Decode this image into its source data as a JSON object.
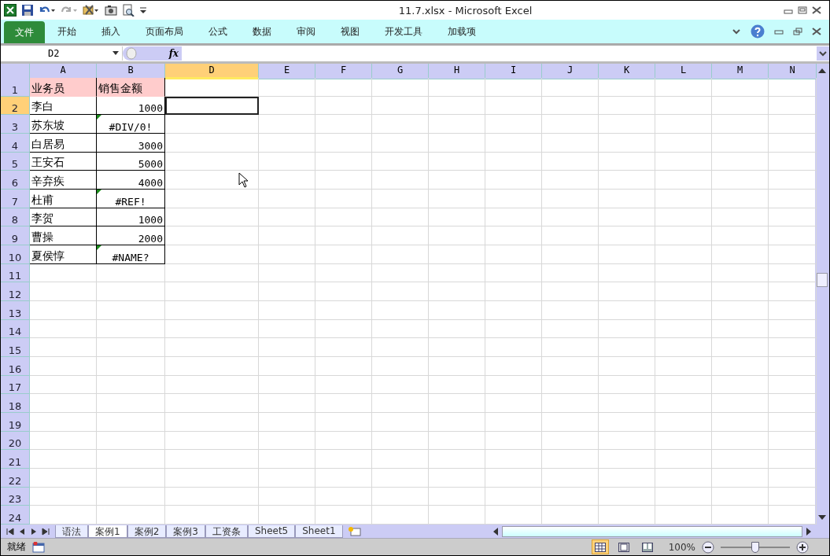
{
  "window": {
    "title": "11.7.xlsx  -  Microsoft Excel"
  },
  "ribbon_tabs": [
    {
      "label": "文件",
      "kind": "file"
    },
    {
      "label": "开始",
      "kind": "tab"
    },
    {
      "label": "插入",
      "kind": "tab"
    },
    {
      "label": "页面布局",
      "kind": "tab"
    },
    {
      "label": "公式",
      "kind": "tab"
    },
    {
      "label": "数据",
      "kind": "tab"
    },
    {
      "label": "审阅",
      "kind": "tab"
    },
    {
      "label": "视图",
      "kind": "tab"
    },
    {
      "label": "开发工具",
      "kind": "tab"
    },
    {
      "label": "加载项",
      "kind": "tab"
    }
  ],
  "formula_bar": {
    "name_box": "D2",
    "fx": "fx"
  },
  "columns": [
    {
      "label": "A",
      "selected": false
    },
    {
      "label": "B",
      "selected": false
    },
    {
      "label": "D",
      "selected": true
    },
    {
      "label": "E",
      "selected": false
    },
    {
      "label": "F",
      "selected": false
    },
    {
      "label": "G",
      "selected": false
    },
    {
      "label": "H",
      "selected": false
    },
    {
      "label": "I",
      "selected": false
    },
    {
      "label": "J",
      "selected": false
    },
    {
      "label": "K",
      "selected": false
    },
    {
      "label": "L",
      "selected": false
    },
    {
      "label": "M",
      "selected": false
    },
    {
      "label": "N",
      "selected": false
    }
  ],
  "rows": [
    {
      "number": "1",
      "selected": false,
      "cells": [
        {
          "text": "业务员",
          "kind": "header",
          "error_flag": false
        },
        {
          "text": "销售金额",
          "kind": "header",
          "error_flag": false
        }
      ]
    },
    {
      "number": "2",
      "selected": true,
      "cells": [
        {
          "text": "李白",
          "kind": "text",
          "error_flag": false
        },
        {
          "text": "1000",
          "kind": "number",
          "error_flag": false
        }
      ]
    },
    {
      "number": "3",
      "selected": false,
      "cells": [
        {
          "text": "苏东坡",
          "kind": "text",
          "error_flag": false
        },
        {
          "text": "#DIV/0!",
          "kind": "error",
          "error_flag": true
        }
      ]
    },
    {
      "number": "4",
      "selected": false,
      "cells": [
        {
          "text": "白居易",
          "kind": "text",
          "error_flag": false
        },
        {
          "text": "3000",
          "kind": "number",
          "error_flag": false
        }
      ]
    },
    {
      "number": "5",
      "selected": false,
      "cells": [
        {
          "text": "王安石",
          "kind": "text",
          "error_flag": false
        },
        {
          "text": "5000",
          "kind": "number",
          "error_flag": false
        }
      ]
    },
    {
      "number": "6",
      "selected": false,
      "cells": [
        {
          "text": "辛弃疾",
          "kind": "text",
          "error_flag": false
        },
        {
          "text": "4000",
          "kind": "number",
          "error_flag": false
        }
      ]
    },
    {
      "number": "7",
      "selected": false,
      "cells": [
        {
          "text": "杜甫",
          "kind": "text",
          "error_flag": false
        },
        {
          "text": "#REF!",
          "kind": "error",
          "error_flag": true
        }
      ]
    },
    {
      "number": "8",
      "selected": false,
      "cells": [
        {
          "text": "李贺",
          "kind": "text",
          "error_flag": false
        },
        {
          "text": "1000",
          "kind": "number",
          "error_flag": false
        }
      ]
    },
    {
      "number": "9",
      "selected": false,
      "cells": [
        {
          "text": "曹操",
          "kind": "text",
          "error_flag": false
        },
        {
          "text": "2000",
          "kind": "number",
          "error_flag": false
        }
      ]
    },
    {
      "number": "10",
      "selected": false,
      "cells": [
        {
          "text": "夏侯惇",
          "kind": "text",
          "error_flag": false
        },
        {
          "text": "#NAME?",
          "kind": "error",
          "error_flag": true
        }
      ]
    },
    {
      "number": "11",
      "selected": false,
      "cells": []
    },
    {
      "number": "12",
      "selected": false,
      "cells": []
    },
    {
      "number": "13",
      "selected": false,
      "cells": []
    },
    {
      "number": "14",
      "selected": false,
      "cells": []
    },
    {
      "number": "15",
      "selected": false,
      "cells": []
    },
    {
      "number": "16",
      "selected": false,
      "cells": []
    },
    {
      "number": "17",
      "selected": false,
      "cells": []
    },
    {
      "number": "18",
      "selected": false,
      "cells": []
    },
    {
      "number": "19",
      "selected": false,
      "cells": []
    },
    {
      "number": "20",
      "selected": false,
      "cells": []
    },
    {
      "number": "21",
      "selected": false,
      "cells": []
    },
    {
      "number": "22",
      "selected": false,
      "cells": []
    },
    {
      "number": "23",
      "selected": false,
      "cells": []
    },
    {
      "number": "24",
      "selected": false,
      "cells": []
    }
  ],
  "sheet_tabs": [
    {
      "label": "语法",
      "selected": false
    },
    {
      "label": "案例1",
      "selected": true
    },
    {
      "label": "案例2",
      "selected": false
    },
    {
      "label": "案例3",
      "selected": false
    },
    {
      "label": "工资条",
      "selected": false
    },
    {
      "label": "Sheet5",
      "selected": false
    },
    {
      "label": "Sheet1",
      "selected": false
    }
  ],
  "status_bar": {
    "status": "就绪",
    "views": [
      {
        "kind": "normal",
        "selected": true
      },
      {
        "kind": "layout",
        "selected": false
      },
      {
        "kind": "pagebreak",
        "selected": false
      }
    ],
    "zoom": "100%",
    "zoom_slider": {
      "level": 0.5
    }
  }
}
